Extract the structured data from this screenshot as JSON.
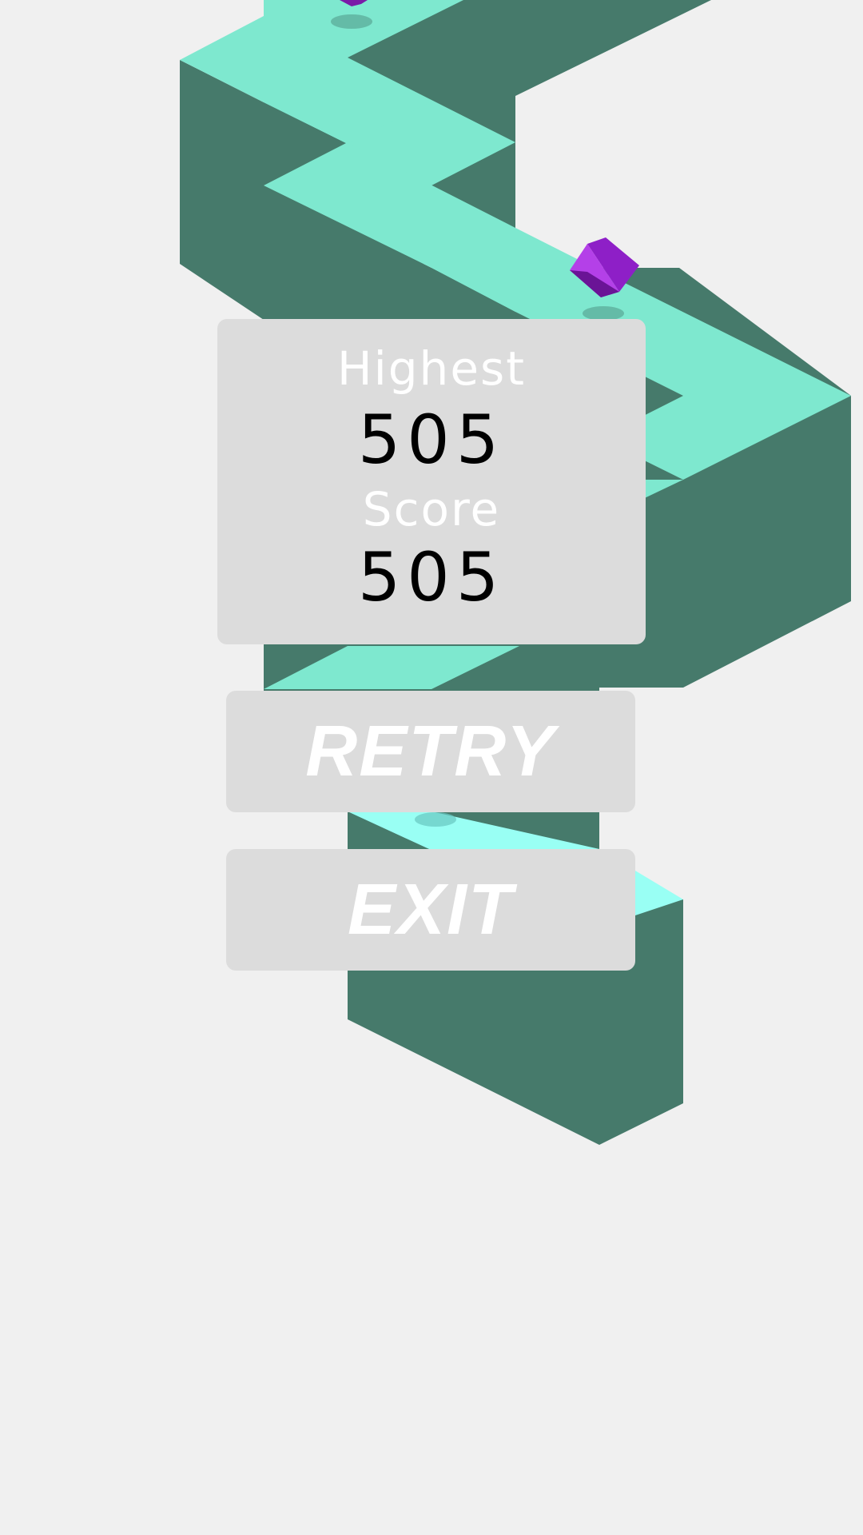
{
  "colors": {
    "background": "#f0f0f0",
    "path_top": "#7ee8cf",
    "path_top_highlight": "#99fff4",
    "path_side": "#467a6b",
    "ball": "#9b24d6",
    "panel": "#dcdcdc",
    "label_text": "#ffffff",
    "value_text": "#000000"
  },
  "score_panel": {
    "highest_label": "Highest",
    "highest_value": "505",
    "score_label": "Score",
    "score_value": "505"
  },
  "buttons": {
    "retry_label": "RETRY",
    "exit_label": "EXIT"
  }
}
